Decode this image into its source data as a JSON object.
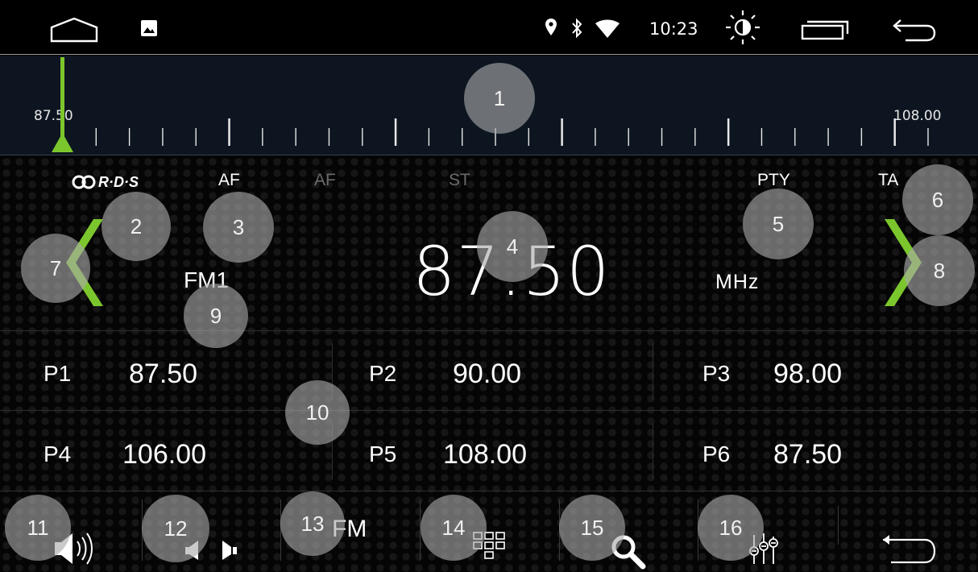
{
  "status_bar": {
    "time": "10:23",
    "icons": [
      "home-icon",
      "gallery-icon",
      "location-icon",
      "bluetooth-icon",
      "wifi-icon",
      "brightness-icon",
      "recent-apps-icon",
      "back-icon"
    ]
  },
  "tuner": {
    "scale_min": "87.50",
    "scale_max": "108.00",
    "current_fraction": 0.0
  },
  "indicators": {
    "rds": "R·D·S",
    "af_on": "AF",
    "af_off": "AF",
    "st": "ST",
    "pty": "PTY",
    "ta": "TA"
  },
  "frequency": {
    "value": "87.50",
    "unit": "MHz",
    "band": "FM1"
  },
  "presets": [
    {
      "name": "P1",
      "value": "87.50"
    },
    {
      "name": "P2",
      "value": "90.00"
    },
    {
      "name": "P3",
      "value": "98.00"
    },
    {
      "name": "P4",
      "value": "106.00"
    },
    {
      "name": "P5",
      "value": "108.00"
    },
    {
      "name": "P6",
      "value": "87.50"
    }
  ],
  "toolbar": {
    "band_label": "FM",
    "buttons": [
      "speaker-icon",
      "seek-icon",
      "band-button",
      "grid-icon",
      "search-icon",
      "equalizer-icon",
      "return-icon"
    ]
  },
  "colors": {
    "accent_green": "#7cc62d",
    "background": "#000000",
    "badge": "#aaaaaa"
  },
  "callouts": [
    "1",
    "2",
    "3",
    "4",
    "5",
    "6",
    "7",
    "8",
    "9",
    "10",
    "11",
    "12",
    "13",
    "14",
    "15",
    "16"
  ]
}
